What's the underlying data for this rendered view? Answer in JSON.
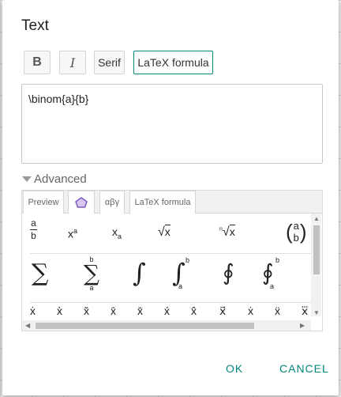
{
  "dialog": {
    "title": "Text",
    "toolbar": {
      "bold_label": "B",
      "italic_label": "I",
      "serif_label": "Serif",
      "latex_label": "LaTeX formula"
    },
    "editor_value": "\\binom{a}{b}",
    "advanced_label": "Advanced",
    "tabs": {
      "preview": "Preview",
      "polygon_icon": "pentagon-icon",
      "greek": "αβγ",
      "latex": "LaTeX formula"
    },
    "symbols": {
      "row1": {
        "frac_num": "a",
        "frac_den": "b",
        "power_base": "x",
        "power_exp": "a",
        "sub_base": "x",
        "sub_idx": "a",
        "sqrt_root": "√",
        "sqrt_arg": "x",
        "nroot_idx": "n",
        "nroot_root": "√",
        "nroot_arg": "x",
        "binom_top": "a",
        "binom_bottom": "b"
      },
      "row2": {
        "sum": "∑",
        "sum_lim": "∑",
        "sum_upper": "b",
        "sum_lower": "a",
        "integral": "∫",
        "integral_lim": "∫",
        "int_upper": "b",
        "int_lower": "a",
        "contour": "∮",
        "contour_lim": "∮",
        "cont_upper": "b",
        "cont_lower": "a"
      },
      "row3": [
        "ẋ",
        "x̀",
        "x̌",
        "x̄",
        "x̆",
        "x́",
        "x̂",
        "x⃗",
        "ẋ",
        "ẍ",
        "x⃛"
      ]
    },
    "ok_label": "OK",
    "cancel_label": "CANCEL",
    "colors": {
      "accent": "#00897b",
      "grid_bg": "#eef0f1"
    }
  }
}
